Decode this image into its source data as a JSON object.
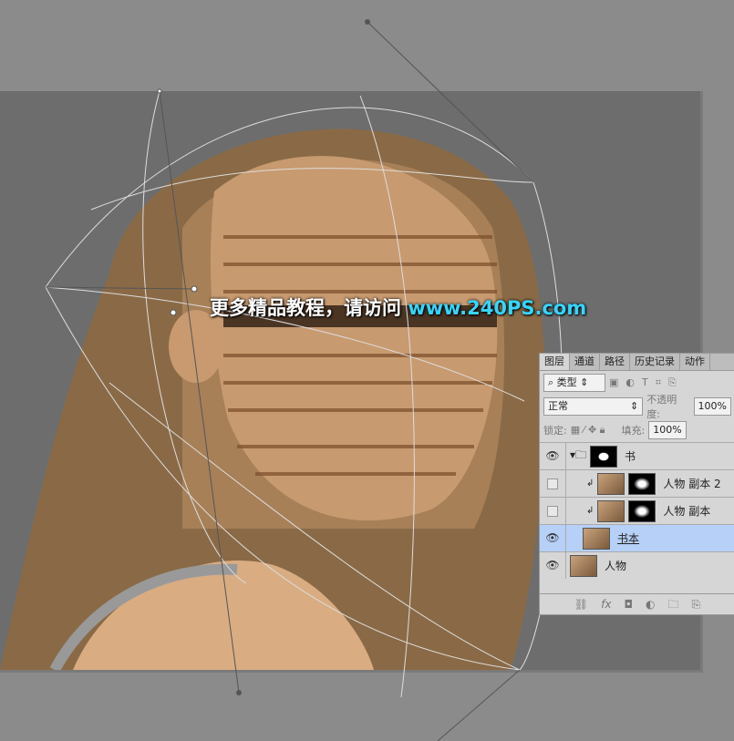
{
  "watermark": {
    "text": "更多精品教程，请访问 ",
    "url": "www.240PS.com"
  },
  "panel": {
    "tabs": [
      "图层",
      "通道",
      "路径",
      "历史记录",
      "动作"
    ],
    "filter_kind": "类型",
    "blend_mode": "正常",
    "opacity_label": "不透明度:",
    "opacity": "100%",
    "lock_label": "锁定:",
    "fill_label": "填充:",
    "fill": "100%",
    "layers": [
      {
        "name": "书",
        "visible": true,
        "type": "group"
      },
      {
        "name": "人物 副本 2",
        "visible": false,
        "type": "clipped"
      },
      {
        "name": "人物 副本",
        "visible": false,
        "type": "clipped"
      },
      {
        "name": "书本",
        "visible": true,
        "type": "smart",
        "selected": true
      },
      {
        "name": "人物",
        "visible": true,
        "type": "normal"
      }
    ]
  },
  "colors": {
    "selected": "#b7d0f7",
    "accent_url": "#35d6ff"
  }
}
